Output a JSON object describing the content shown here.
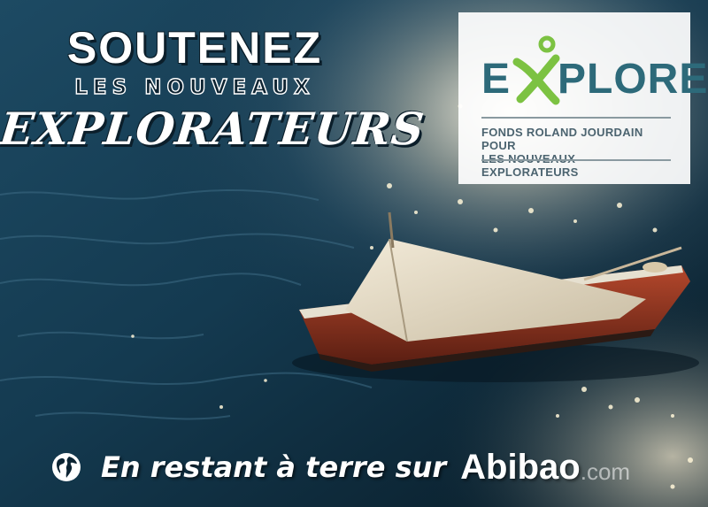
{
  "headline": {
    "line1": "SOUTENEZ",
    "line2": "LES NOUVEAUX",
    "line3": "EXPLORATEURS"
  },
  "logo": {
    "word_first": "E",
    "word_rest": "PLORE",
    "subtitle_line1": "FONDS ROLAND JOURDAIN POUR",
    "subtitle_line2": "LES NOUVEAUX EXPLORATEURS"
  },
  "footer": {
    "tagline": "En restant à terre sur",
    "brand": "Abibao",
    "brand_tld": ".com"
  },
  "colors": {
    "logo_teal": "#2d6a7a",
    "logo_green": "#7cc242",
    "sea_dark": "#0c2433"
  },
  "icons": {
    "globe": "globe-icon",
    "logo_x": "explore-figure-icon"
  }
}
